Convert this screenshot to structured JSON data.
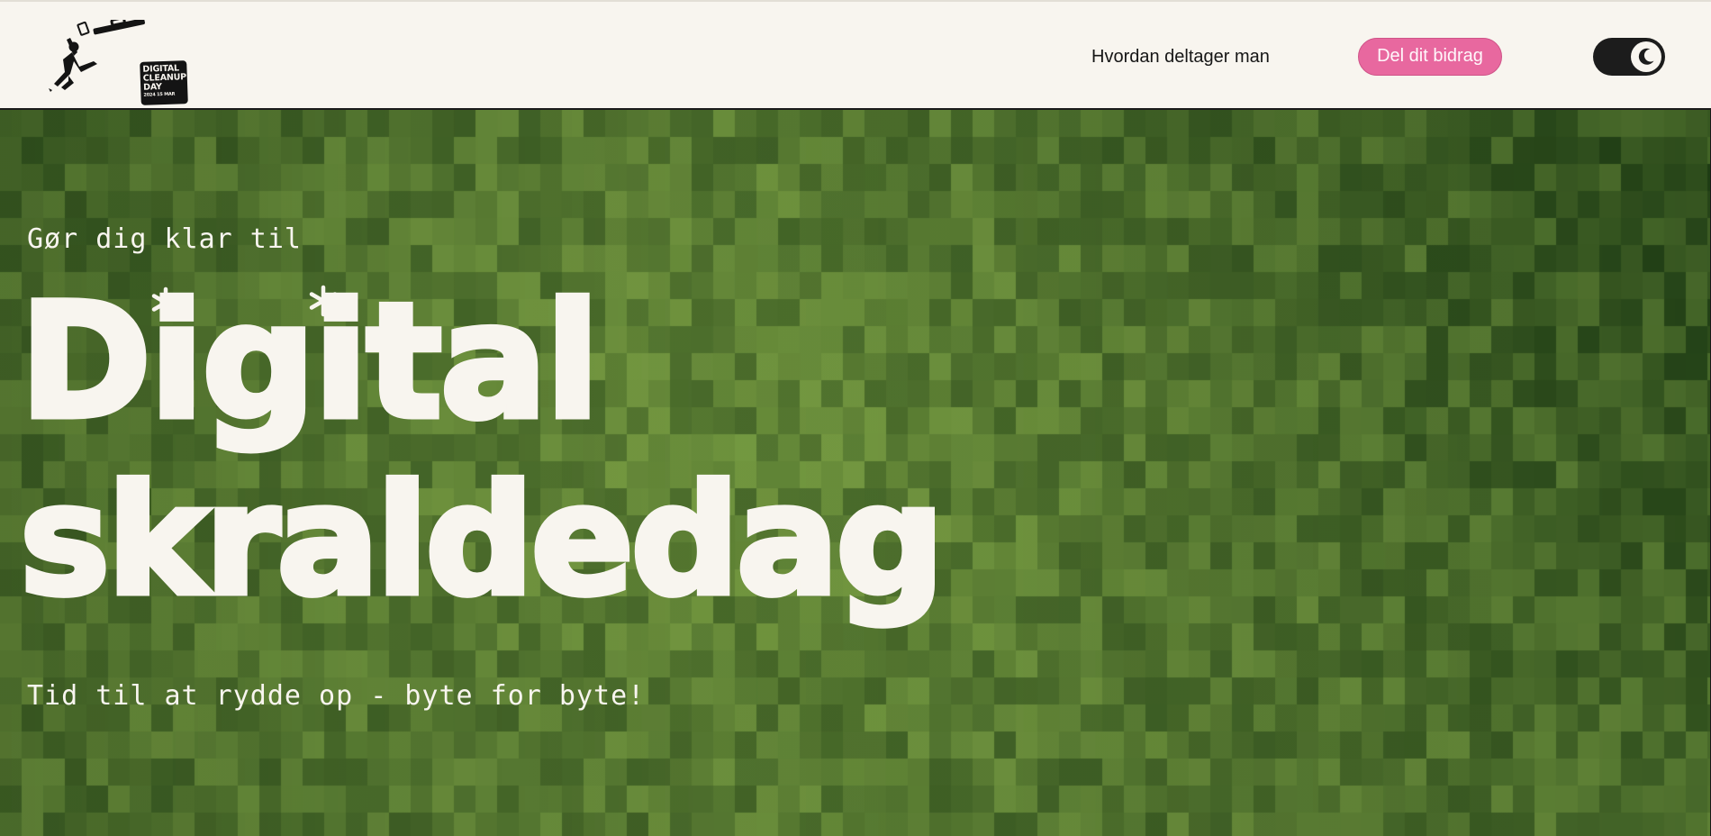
{
  "header": {
    "logo": {
      "icon": "trash-bin-figure-icon",
      "text_lines": [
        "DIGITAL",
        "CLEANUP",
        "DAY"
      ],
      "year_line": "2024 15 MAR"
    },
    "nav_link_label": "Hvordan deltager man",
    "cta_label": "Del dit bidrag",
    "theme_toggle_icon": "moon-icon"
  },
  "hero": {
    "pre_title": "Gør dig klar til",
    "title_line1": "Digital",
    "title_line2": "skraldedag",
    "tagline": "Tid til at rydde op - byte for byte!",
    "background": "pixelated-grass-image"
  },
  "colors": {
    "header_bg": "#f8f5ef",
    "accent_pink": "#e8689f",
    "hero_text": "#f8f5ef",
    "grass_dark": "#1f3d14",
    "grass_light": "#7fa857"
  }
}
